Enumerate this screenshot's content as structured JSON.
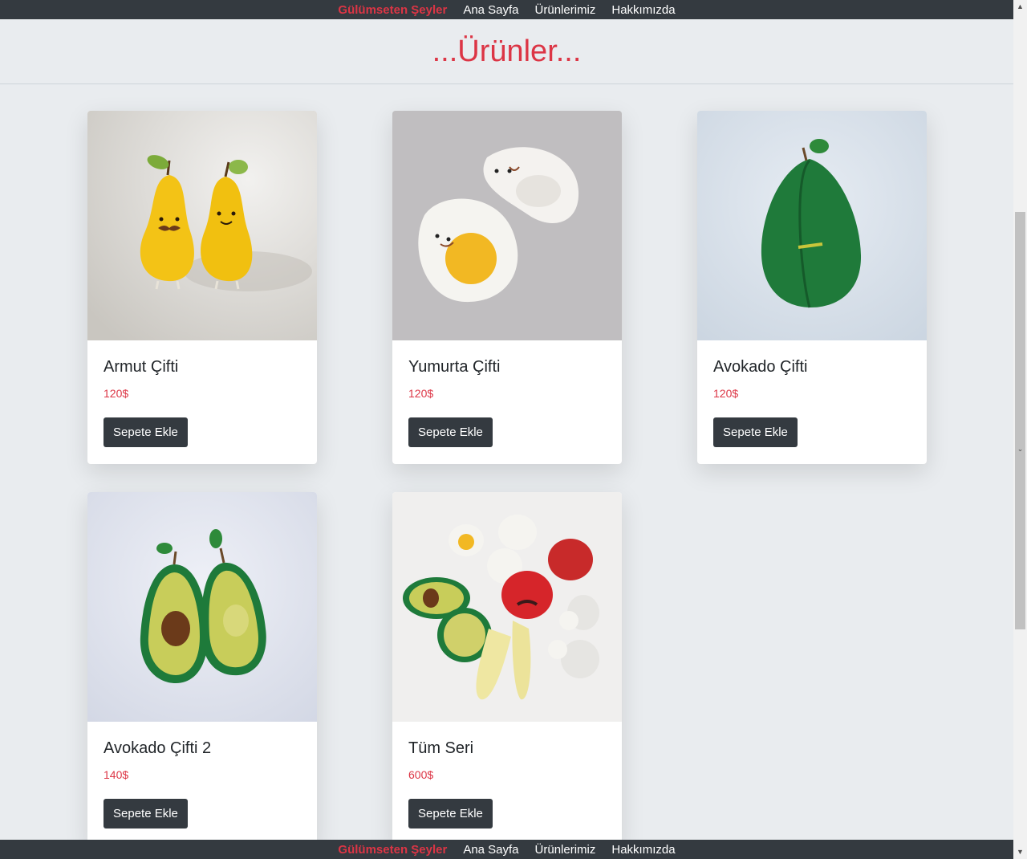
{
  "nav": {
    "brand": "Gülümseten Şeyler",
    "links": [
      "Ana Sayfa",
      "Ürünlerimiz",
      "Hakkımızda"
    ]
  },
  "header": {
    "title": "...Ürünler..."
  },
  "products": [
    {
      "name": "Armut Çifti",
      "price": "120$",
      "button": "Sepete Ekle"
    },
    {
      "name": "Yumurta Çifti",
      "price": "120$",
      "button": "Sepete Ekle"
    },
    {
      "name": "Avokado Çifti",
      "price": "120$",
      "button": "Sepete Ekle"
    },
    {
      "name": "Avokado Çifti 2",
      "price": "140$",
      "button": "Sepete Ekle"
    },
    {
      "name": "Tüm Seri",
      "price": "600$",
      "button": "Sepete Ekle"
    }
  ],
  "colors": {
    "accent": "#dc3545",
    "navbar": "#343a40",
    "page_bg": "#e9ecef"
  }
}
